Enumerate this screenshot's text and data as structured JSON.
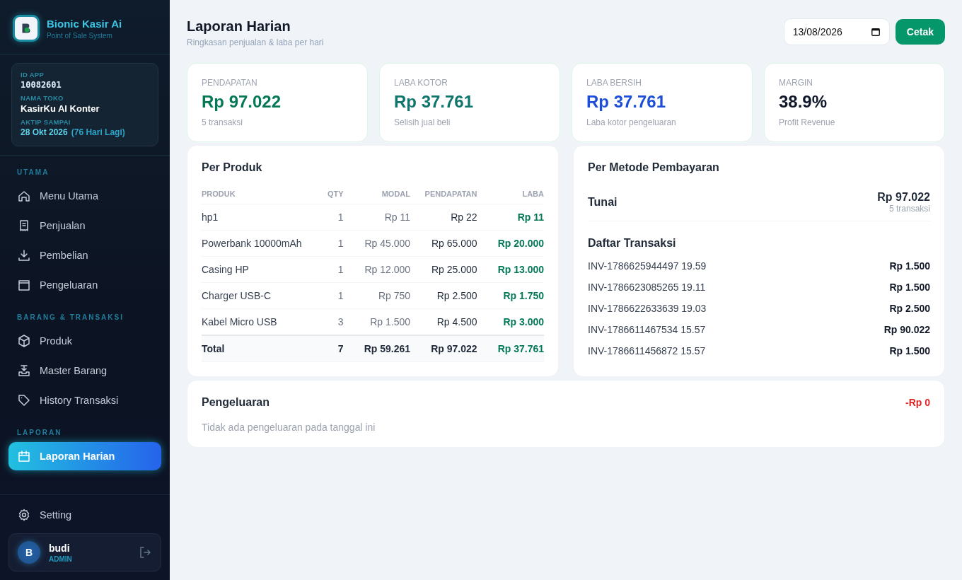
{
  "sidebar": {
    "brand": {
      "name": "Bionic Kasir Ai",
      "tagline": "Point of Sale System"
    },
    "info": [
      {
        "label": "ID APP",
        "value": "10082601",
        "kind": "mono"
      },
      {
        "label": "NAMA TOKO",
        "value": "KasirKu AI Konter",
        "kind": "plain"
      },
      {
        "label": "AKTIP SAMPAI",
        "value": "28 Okt 2026",
        "extra": "(76 Hari Lagi)",
        "kind": "date"
      }
    ],
    "sections": [
      {
        "title": "UTAMA",
        "items": [
          {
            "label": "Menu Utama",
            "selected": false
          },
          {
            "label": "Penjualan",
            "selected": false
          },
          {
            "label": "Pembelian",
            "selected": false
          },
          {
            "label": "Pengeluaran",
            "selected": false
          }
        ]
      },
      {
        "title": "BARANG & TRANSAKSI",
        "items": [
          {
            "label": "Produk",
            "selected": false
          },
          {
            "label": "Master Barang",
            "selected": false
          },
          {
            "label": "History Transaksi",
            "selected": false
          }
        ]
      },
      {
        "title": "LAPORAN",
        "items": [
          {
            "label": "Laporan Harian",
            "selected": true
          }
        ]
      }
    ],
    "setting": {
      "label": "Setting"
    },
    "user": {
      "initial": "B",
      "name": "budi",
      "role": "ADMIN"
    }
  },
  "header": {
    "title": "Laporan Harian",
    "subtitle": "Ringkasan penjualan & laba per hari",
    "date": "13/08/2026",
    "print_button": "Cetak"
  },
  "stats": [
    {
      "label": "PENDAPATAN",
      "value": "Rp 97.022",
      "note": "5 transaksi",
      "color": "#047857"
    },
    {
      "label": "LABA KOTOR",
      "value": "Rp 37.761",
      "note": "Selisih jual beli",
      "color": "#0f766e"
    },
    {
      "label": "LABA BERSIH",
      "value": "Rp 37.761",
      "note": "Laba kotor pengeluaran",
      "color": "#1d4ed8"
    },
    {
      "label": "MARGIN",
      "value": "38.9%",
      "note": "Profit Revenue",
      "color": "#0f172a"
    }
  ],
  "per_produk": {
    "title": "Per Produk",
    "columns": [
      "PRODUK",
      "QTY",
      "MODAL",
      "PENDAPATAN",
      "LABA"
    ],
    "rows": [
      [
        "hp1",
        "1",
        "Rp 11",
        "Rp 22",
        "Rp 11"
      ],
      [
        "Powerbank 10000mAh",
        "1",
        "Rp 45.000",
        "Rp 65.000",
        "Rp 20.000"
      ],
      [
        "Casing HP",
        "1",
        "Rp 12.000",
        "Rp 25.000",
        "Rp 13.000"
      ],
      [
        "Charger USB-C",
        "1",
        "Rp 750",
        "Rp 2.500",
        "Rp 1.750"
      ],
      [
        "Kabel Micro USB",
        "3",
        "Rp 1.500",
        "Rp 4.500",
        "Rp 3.000"
      ]
    ],
    "total": [
      "Total",
      "7",
      "Rp 59.261",
      "Rp 97.022",
      "Rp 37.761"
    ]
  },
  "per_metode": {
    "title": "Per Metode Pembayaran",
    "methods": [
      {
        "name": "Tunai",
        "amount": "Rp 97.022",
        "count": "5 transaksi"
      }
    ],
    "transactions_title": "Daftar Transaksi",
    "transactions": [
      {
        "id": "INV-1786625944497 19.59",
        "amount": "Rp 1.500"
      },
      {
        "id": "INV-1786623085265 19.11",
        "amount": "Rp 1.500"
      },
      {
        "id": "INV-1786622633639 19.03",
        "amount": "Rp 2.500"
      },
      {
        "id": "INV-1786611467534 15.57",
        "amount": "Rp 90.022"
      },
      {
        "id": "INV-1786611456872 15.57",
        "amount": "Rp 1.500"
      }
    ]
  },
  "pengeluaran": {
    "title": "Pengeluaran",
    "total": "-Rp 0",
    "empty": "Tidak ada pengeluaran pada tanggal ini"
  }
}
